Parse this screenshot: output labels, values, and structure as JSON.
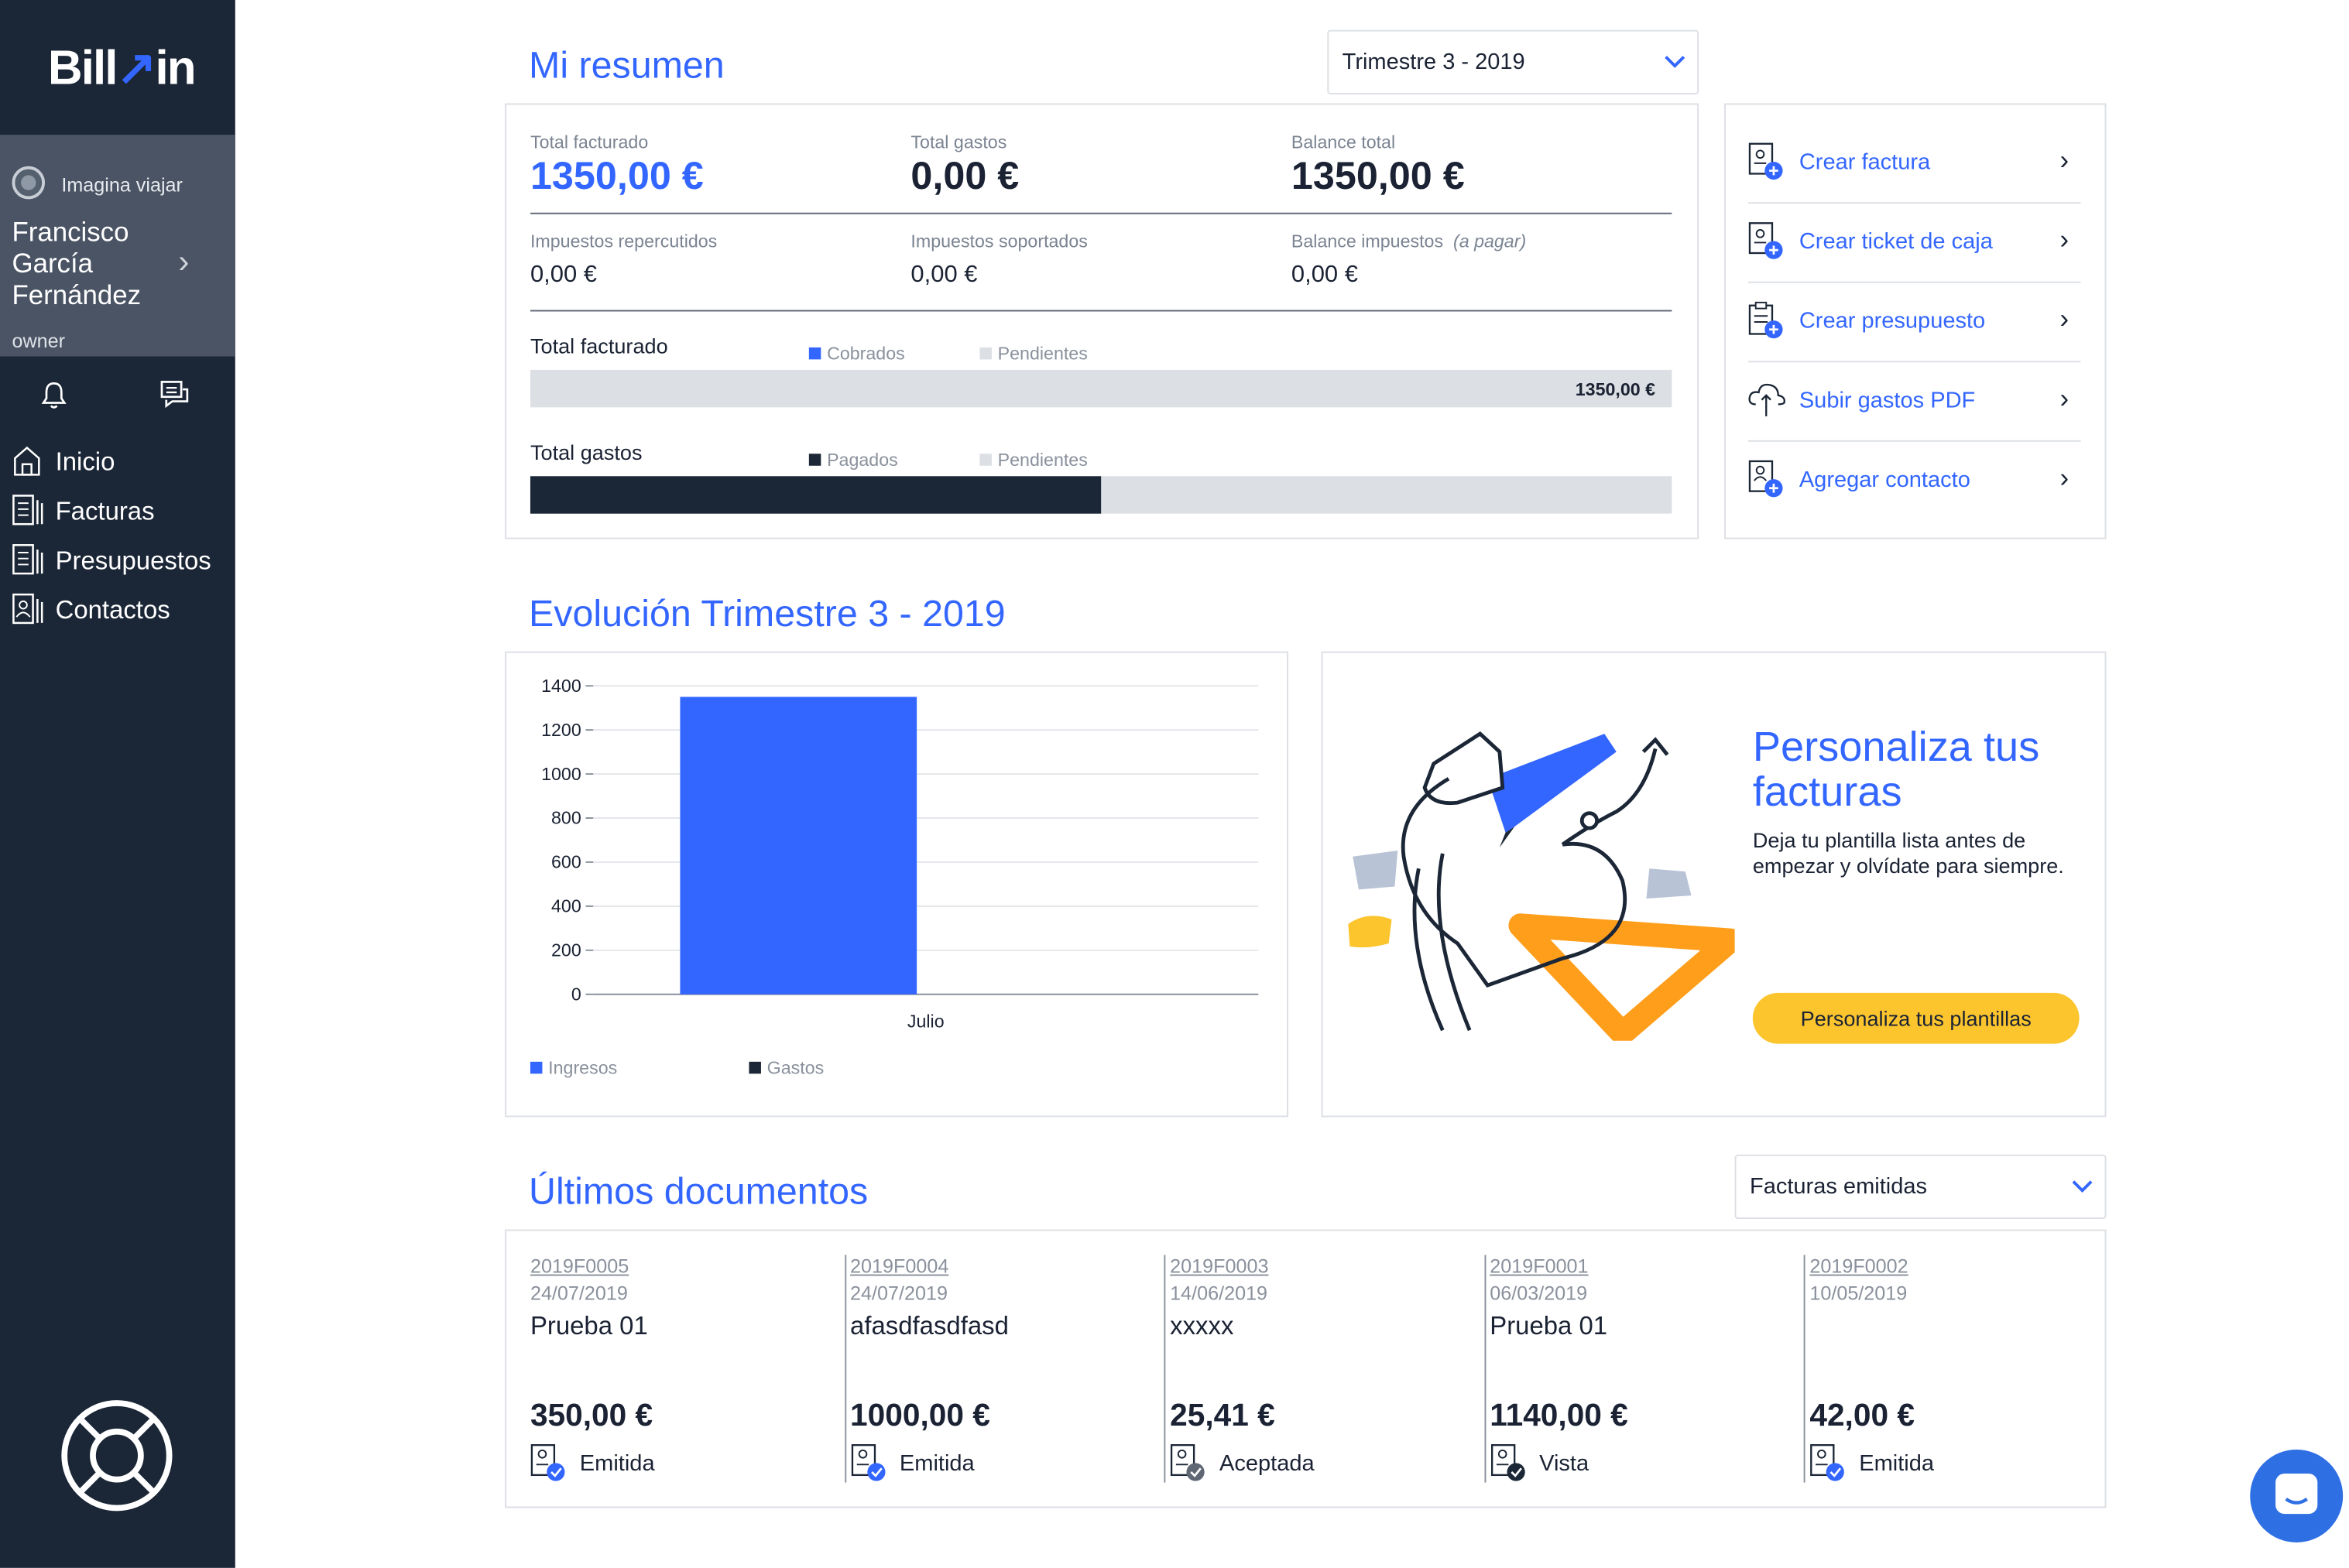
{
  "sidebar": {
    "logo": {
      "pre": "Bill",
      "arrow": "↗",
      "post": "in"
    },
    "company": "Imagina viajar",
    "user_name": "Francisco García Fernández",
    "role": "owner",
    "icons": [
      "bell-icon",
      "messages-icon",
      "help-lifebuoy-icon"
    ],
    "nav": [
      {
        "label": "Inicio",
        "icon": "home-icon"
      },
      {
        "label": "Facturas",
        "icon": "document-icon"
      },
      {
        "label": "Presupuestos",
        "icon": "document-icon"
      },
      {
        "label": "Contactos",
        "icon": "contact-icon"
      }
    ]
  },
  "summary": {
    "title": "Mi resumen",
    "period": "Trimestre 3 - 2019",
    "total_facturado_label": "Total facturado",
    "total_facturado": "1350,00 €",
    "total_gastos_label": "Total gastos",
    "total_gastos": "0,00 €",
    "balance_total_label": "Balance total",
    "balance_total": "1350,00 €",
    "imp_rep_label": "Impuestos repercutidos",
    "imp_rep": "0,00 €",
    "imp_sop_label": "Impuestos soportados",
    "imp_sop": "0,00 €",
    "bal_imp_label": "Balance impuestos",
    "bal_imp_note": "(a pagar)",
    "bal_imp": "0,00 €",
    "bar1": {
      "label": "Total facturado",
      "legend": [
        "Cobrados",
        "Pendientes"
      ],
      "value_label": "1350,00 €",
      "fill_fraction": 0
    },
    "bar2": {
      "label": "Total gastos",
      "legend": [
        "Pagados",
        "Pendientes"
      ],
      "fill_fraction": 0.5
    }
  },
  "quick_actions": [
    {
      "label": "Crear factura",
      "icon": "invoice-add-icon"
    },
    {
      "label": "Crear ticket de caja",
      "icon": "invoice-add-icon"
    },
    {
      "label": "Crear presupuesto",
      "icon": "clipboard-add-icon"
    },
    {
      "label": "Subir gastos PDF",
      "icon": "cloud-upload-icon"
    },
    {
      "label": "Agregar contacto",
      "icon": "contact-add-icon"
    }
  ],
  "evolution": {
    "title": "Evolución Trimestre 3 - 2019",
    "legend": [
      "Ingresos",
      "Gastos"
    ]
  },
  "chart_data": {
    "type": "bar",
    "categories": [
      "Julio"
    ],
    "series": [
      {
        "name": "Ingresos",
        "values": [
          1350
        ],
        "color": "#3366ff"
      },
      {
        "name": "Gastos",
        "values": [
          0
        ],
        "color": "#1b2636"
      }
    ],
    "yticks": [
      0,
      200,
      400,
      600,
      800,
      1000,
      1200,
      1400
    ],
    "ylim": [
      0,
      1400
    ],
    "grid": true,
    "legend_position": "bottom-left"
  },
  "promo": {
    "title": "Personaliza tus facturas",
    "text": "Deja tu plantilla lista antes de empezar y olvídate para siempre.",
    "button": "Personaliza tus plantillas"
  },
  "docs": {
    "title": "Últimos documentos",
    "filter": "Facturas emitidas",
    "items": [
      {
        "number": "2019F0005",
        "date": "24/07/2019",
        "name": "Prueba 01",
        "amount": "350,00 €",
        "status": "Emitida"
      },
      {
        "number": "2019F0004",
        "date": "24/07/2019",
        "name": "afasdfasdfasd",
        "amount": "1000,00 €",
        "status": "Emitida"
      },
      {
        "number": "2019F0003",
        "date": "14/06/2019",
        "name": "xxxxx",
        "amount": "25,41 €",
        "status": "Aceptada"
      },
      {
        "number": "2019F0001",
        "date": "06/03/2019",
        "name": "Prueba 01",
        "amount": "1140,00 €",
        "status": "Vista"
      },
      {
        "number": "2019F0002",
        "date": "10/05/2019",
        "name": "",
        "amount": "42,00 €",
        "status": "Emitida"
      }
    ]
  },
  "colors": {
    "accent": "#3366ff",
    "sidebar": "#1b2636",
    "promo_button": "#fcc52e",
    "bar_track": "#dcdfe3"
  }
}
